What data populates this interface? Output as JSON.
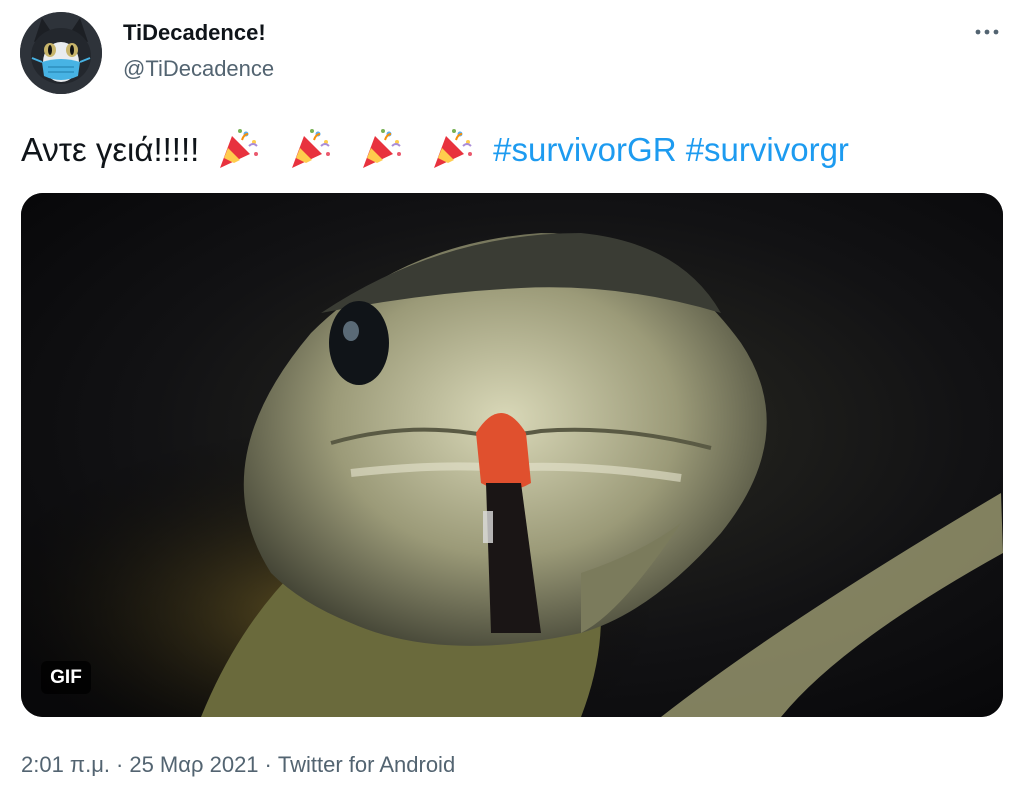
{
  "author": {
    "display_name": "TiDecadence!",
    "handle": "@TiDecadence",
    "avatar_icon": "cat-with-mask-avatar"
  },
  "more_menu_icon": "more-horizontal-icon",
  "tweet": {
    "text_prefix": "Αντε γειά!!!!!",
    "emojis": [
      "party-popper-icon",
      "party-popper-icon",
      "party-popper-icon",
      "party-popper-icon"
    ],
    "hashtags": [
      "#survivorGR",
      "#survivorgr"
    ]
  },
  "media": {
    "type": "gif",
    "badge": "GIF",
    "subject": "snake-with-tongue"
  },
  "meta": {
    "time": "2:01 π.μ.",
    "separator": "·",
    "date": "25 Μαρ 2021",
    "source": "Twitter for Android"
  },
  "colors": {
    "accent": "#1d9bf0",
    "secondary_text": "#536471",
    "primary_text": "#0f1419"
  }
}
